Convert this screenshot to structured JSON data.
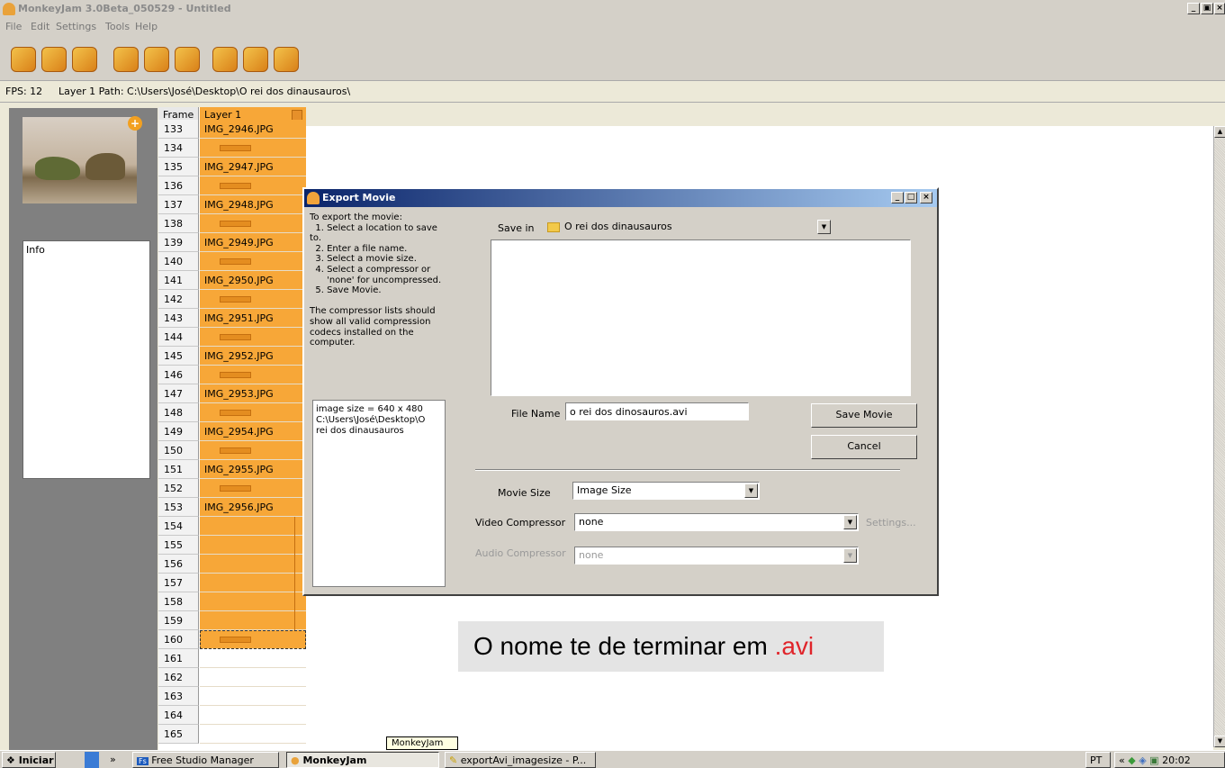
{
  "window": {
    "title": "MonkeyJam 3.0Beta_050529 - Untitled"
  },
  "menu": [
    "File",
    "Edit",
    "Settings",
    "Tools",
    "Help"
  ],
  "status": {
    "fps": "FPS: 12",
    "layer_path": "Layer 1 Path: C:\\Users\\José\\Desktop\\O rei dos dinausauros\\"
  },
  "left_panel": {
    "info_label": "Info"
  },
  "timeline": {
    "frame_header": "Frame",
    "layer_header": "Layer 1",
    "rows": [
      {
        "frame": "133",
        "file": "IMG_2946.JPG"
      },
      {
        "frame": "134",
        "file": ""
      },
      {
        "frame": "135",
        "file": "IMG_2947.JPG"
      },
      {
        "frame": "136",
        "file": ""
      },
      {
        "frame": "137",
        "file": "IMG_2948.JPG"
      },
      {
        "frame": "138",
        "file": ""
      },
      {
        "frame": "139",
        "file": "IMG_2949.JPG"
      },
      {
        "frame": "140",
        "file": ""
      },
      {
        "frame": "141",
        "file": "IMG_2950.JPG"
      },
      {
        "frame": "142",
        "file": ""
      },
      {
        "frame": "143",
        "file": "IMG_2951.JPG"
      },
      {
        "frame": "144",
        "file": ""
      },
      {
        "frame": "145",
        "file": "IMG_2952.JPG"
      },
      {
        "frame": "146",
        "file": ""
      },
      {
        "frame": "147",
        "file": "IMG_2953.JPG"
      },
      {
        "frame": "148",
        "file": ""
      },
      {
        "frame": "149",
        "file": "IMG_2954.JPG"
      },
      {
        "frame": "150",
        "file": ""
      },
      {
        "frame": "151",
        "file": "IMG_2955.JPG"
      },
      {
        "frame": "152",
        "file": ""
      },
      {
        "frame": "153",
        "file": "IMG_2956.JPG"
      },
      {
        "frame": "154",
        "file": ""
      },
      {
        "frame": "155",
        "file": ""
      },
      {
        "frame": "156",
        "file": ""
      },
      {
        "frame": "157",
        "file": ""
      },
      {
        "frame": "158",
        "file": ""
      },
      {
        "frame": "159",
        "file": ""
      },
      {
        "frame": "160",
        "file": ""
      },
      {
        "frame": "161",
        "file": ""
      },
      {
        "frame": "162",
        "file": ""
      },
      {
        "frame": "163",
        "file": ""
      },
      {
        "frame": "164",
        "file": ""
      },
      {
        "frame": "165",
        "file": ""
      }
    ]
  },
  "dialog": {
    "title": "Export Movie",
    "instructions": "To export the movie:\n  1. Select a location to save\nto.\n  2. Enter a file name.\n  3. Select a movie size.\n  4. Select a compressor or\n      'none' for uncompressed.\n  5. Save Movie.\n\nThe compressor lists should\nshow all valid compression\ncodecs installed on the\ncomputer.",
    "info_text": "image size = 640 x 480\nC:\\Users\\José\\Desktop\\O\nrei dos dinausauros",
    "save_in_label": "Save in",
    "save_in_value": "O rei dos dinausauros",
    "file_name_label": "File Name",
    "file_name_value": "o rei dos dinosauros.avi",
    "save_button": "Save Movie",
    "cancel_button": "Cancel",
    "movie_size_label": "Movie Size",
    "movie_size_value": "Image Size",
    "video_compressor_label": "Video Compressor",
    "video_compressor_value": "none",
    "settings_button": "Settings...",
    "audio_compressor_label": "Audio Compressor",
    "audio_compressor_value": "none"
  },
  "annotation": {
    "text": "O nome te de terminar em ",
    "highlight": ".avi",
    "highlight_color": "#e0242a"
  },
  "tooltip": "MonkeyJam",
  "taskbar": {
    "start": "Iniciar",
    "chevron": "»",
    "items": [
      "Free Studio Manager",
      "MonkeyJam",
      "exportAvi_imagesize - P..."
    ],
    "language": "PT",
    "tray_chevron": "«",
    "clock": "20:02"
  }
}
